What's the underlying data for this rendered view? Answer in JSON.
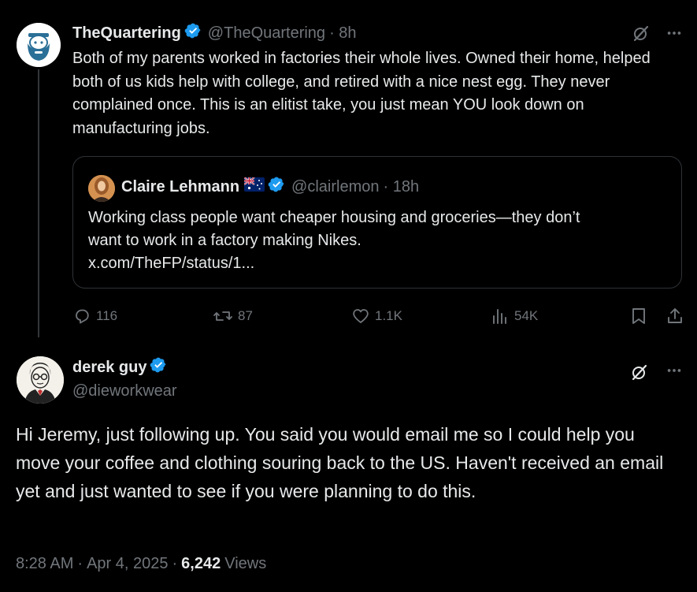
{
  "tweet1": {
    "name": "TheQuartering",
    "handle": "@TheQuartering",
    "time": "· 8h",
    "text": "Both of my parents worked in factories their whole lives. Owned their home, helped both of us kids help with college, and retired with a nice nest egg. They never complained once. This is an elitist take, you just mean YOU look down on manufacturing jobs.",
    "avatar_icon": "bearded-man-avatar-icon"
  },
  "quote": {
    "name": "Claire Lehmann",
    "flag": "australia-flag-icon",
    "handle": "@clairlemon",
    "time": "· 18h",
    "text_line1": "Working class people want cheaper housing and groceries—they don’t",
    "text_line2": "want to work in a factory making Nikes.",
    "link": "x.com/TheFP/status/1..."
  },
  "actions": {
    "replies": "116",
    "reposts": "87",
    "likes": "1.1K",
    "views": "54K"
  },
  "tweet2": {
    "name": "derek guy",
    "handle": "@dieworkwear",
    "text": "Hi Jeremy, just following up. You said you would email me so I could help you move your coffee and clothing souring back to the US. Haven't received an email yet and just wanted to see if you were planning to do this.",
    "time": "8:28 AM",
    "date": "Apr 4, 2025",
    "views_count": "6,242",
    "views_label": "Views"
  },
  "colors": {
    "background": "#000000",
    "text": "#e7e9ea",
    "muted": "#71767b",
    "verified": "#1d9bf0",
    "border": "#2f3336"
  }
}
